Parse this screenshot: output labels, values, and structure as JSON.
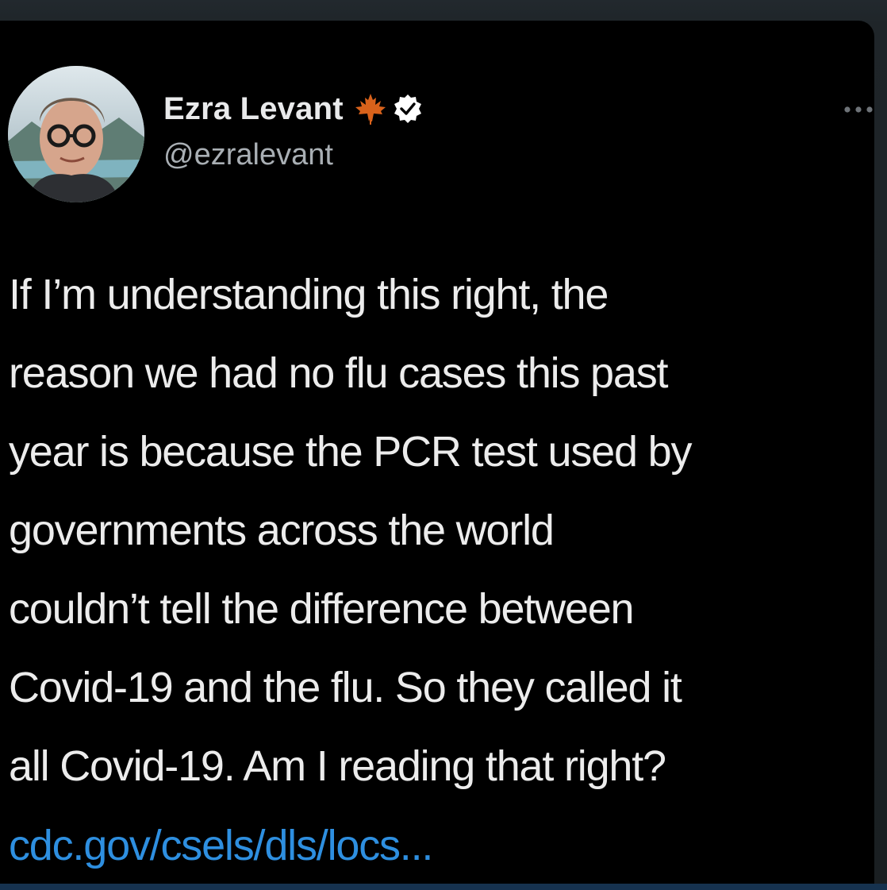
{
  "tweet": {
    "author": {
      "display_name": "Ezra Levant",
      "handle": "@ezralevant",
      "name_badge_icon": "maple-leaf-icon",
      "verified_icon": "verified-badge-icon",
      "avatar_icon": "avatar-photo"
    },
    "more_icon": "more-options-icon",
    "text": "If I’m understanding this right, the\nreason we had no flu cases this past\nyear is because the PCR test used by\ngovernments across the world\ncouldn’t tell the difference between\nCovid-19 and the flu. So they called it\nall Covid-19. Am I reading that right?",
    "link": "cdc.gov/csels/dls/locs..."
  },
  "colors": {
    "background": "#000000",
    "text": "#ececec",
    "secondary_text": "#a9afb4",
    "link": "#2e8fe0",
    "maple_leaf": "#d9621b",
    "verified_badge": "#ffffff"
  }
}
